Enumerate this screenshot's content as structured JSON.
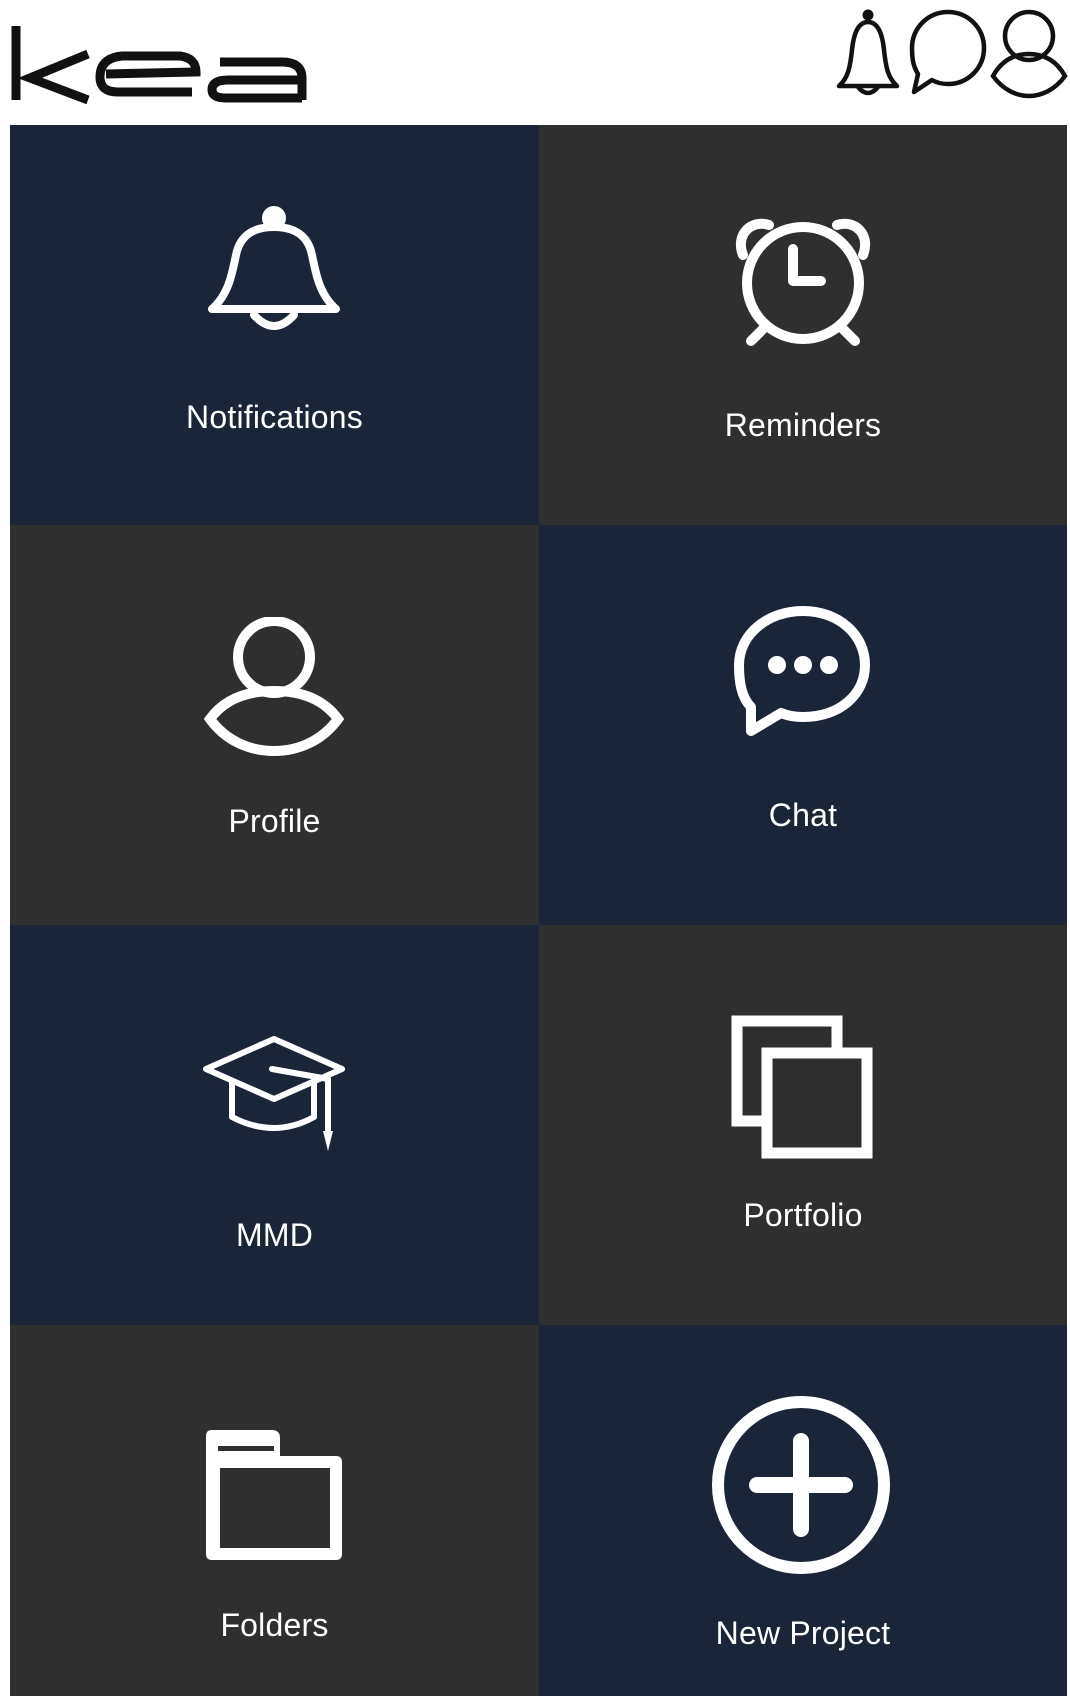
{
  "header": {
    "logo_text": "kea",
    "icons": [
      "bell-icon",
      "chat-bubble-icon",
      "user-icon"
    ]
  },
  "colors": {
    "tile_navy": "#1b2538",
    "tile_dark": "#2f2f2f",
    "text": "#ffffff",
    "header_icons": "#111111"
  },
  "tiles": [
    {
      "label": "Notifications",
      "icon": "bell-icon"
    },
    {
      "label": "Reminders",
      "icon": "alarm-clock-icon"
    },
    {
      "label": "Profile",
      "icon": "user-icon"
    },
    {
      "label": "Chat",
      "icon": "chat-bubble-icon"
    },
    {
      "label": "MMD",
      "icon": "graduation-cap-icon"
    },
    {
      "label": "Portfolio",
      "icon": "stacked-squares-icon"
    },
    {
      "label": "Folders",
      "icon": "folder-icon"
    },
    {
      "label": "New Project",
      "icon": "plus-circle-icon"
    }
  ]
}
